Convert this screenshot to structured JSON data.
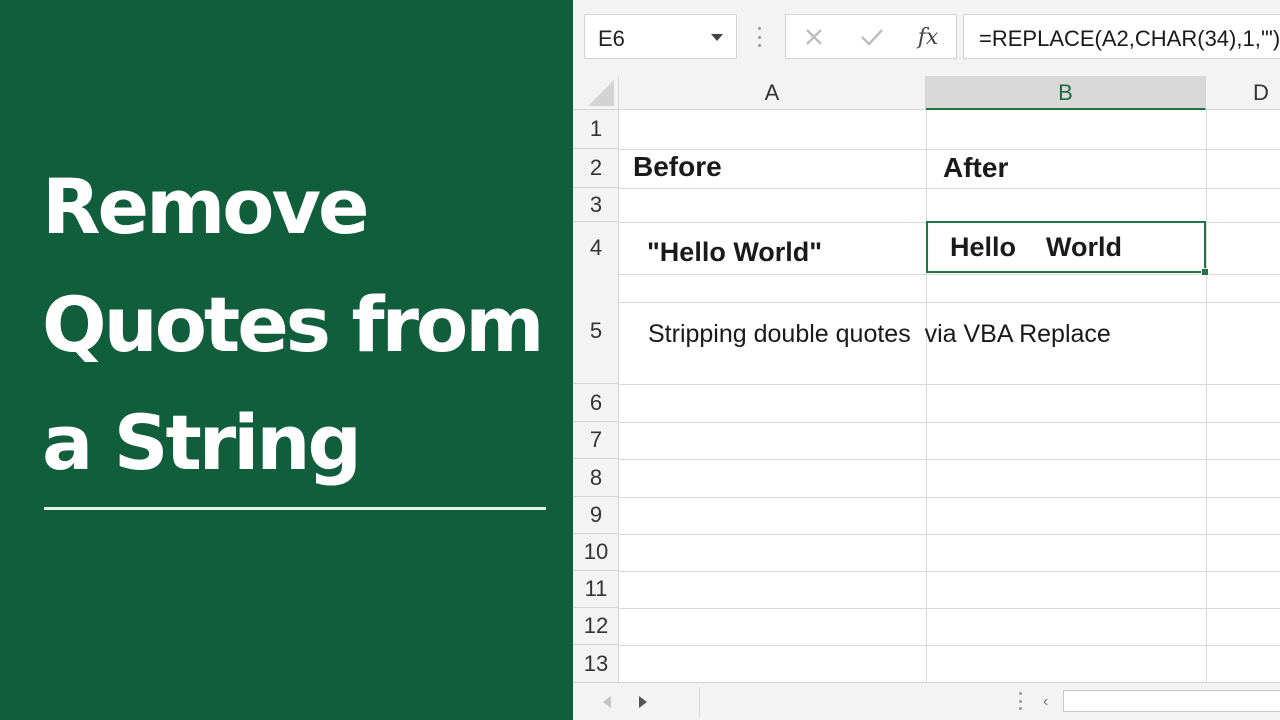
{
  "banner": {
    "title_lines": [
      "Remove",
      "Quotes from",
      "a String"
    ]
  },
  "formula_bar": {
    "name_box": "E6",
    "cancel_icon": "×",
    "enter_icon": "✓",
    "fx_label": "fx",
    "formula": "=REPLACE(A2,CHAR(34),1,'\")"
  },
  "columns": [
    "A",
    "B",
    "D"
  ],
  "active_column": "B",
  "rows": [
    "1",
    "2",
    "3",
    "4",
    "5",
    "6",
    "7",
    "8",
    "9",
    "10",
    "11",
    "12",
    "13"
  ],
  "cells": {
    "A2": "Before",
    "B2": "After",
    "A4": "\"Hello World\"",
    "B4": "Hello    World",
    "A5": "Stripping double quotes  via VBA Replace"
  },
  "selected_cell": "B4",
  "colors": {
    "banner_bg": "#115e3c",
    "excel_green": "#217346"
  }
}
